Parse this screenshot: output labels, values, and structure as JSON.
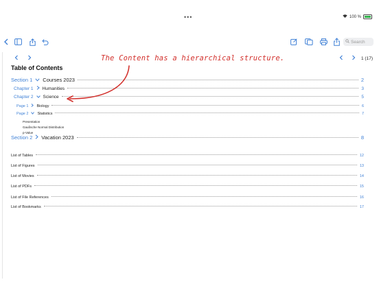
{
  "status": {
    "dots": "•••",
    "battery_percent": "100 %"
  },
  "toolbar": {
    "search_placeholder": "Search"
  },
  "pager": {
    "page_count": "1 (17)"
  },
  "toc": {
    "title": "Table of Contents",
    "entries": [
      {
        "prefix": "Section 1",
        "label": "Courses 2023",
        "page": "2"
      },
      {
        "prefix": "Chapter 1",
        "label": "Humanities",
        "page": "3"
      },
      {
        "prefix": "Chapter 2",
        "label": "Science",
        "page": "5"
      },
      {
        "prefix": "Page 1",
        "label": "Biology",
        "page": "6"
      },
      {
        "prefix": "Page 2",
        "label": "Statistics",
        "page": "7"
      },
      {
        "label": "Presentation"
      },
      {
        "label": "Gaußsche Normal Distribution"
      },
      {
        "label": "p-Value"
      },
      {
        "prefix": "Section 2",
        "label": "Vacation 2023",
        "page": "8"
      }
    ],
    "lists": [
      {
        "label": "List of Tables",
        "page": "12"
      },
      {
        "label": "List of Figures",
        "page": "13"
      },
      {
        "label": "List of Movies",
        "page": "14"
      },
      {
        "label": "List of PDFs",
        "page": "15"
      },
      {
        "label": "List of File References",
        "page": "16"
      },
      {
        "label": "List of Bookmarks",
        "page": "17"
      }
    ]
  },
  "annotation": {
    "text": "The Content has a hierarchical structure.",
    "color": "#d2302c"
  },
  "colors": {
    "accent": "#3f80d6",
    "battery": "#30b14a"
  }
}
